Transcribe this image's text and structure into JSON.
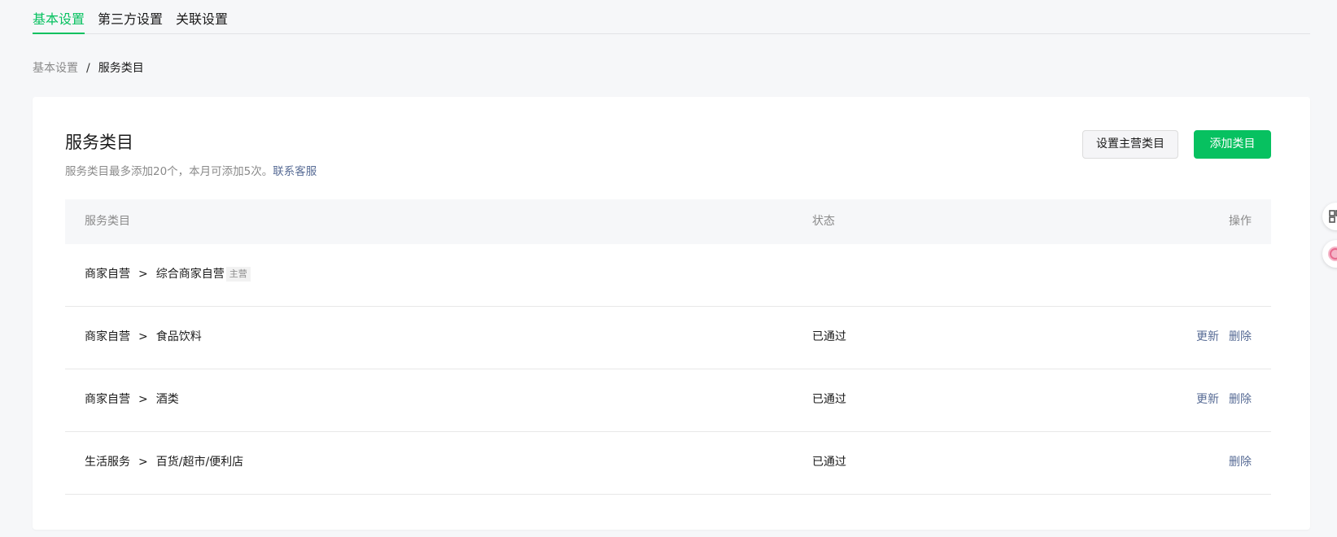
{
  "tabs": [
    {
      "label": "基本设置",
      "active": true
    },
    {
      "label": "第三方设置",
      "active": false
    },
    {
      "label": "关联设置",
      "active": false
    }
  ],
  "breadcrumb": {
    "root": "基本设置",
    "separator": "/",
    "current": "服务类目"
  },
  "card": {
    "title": "服务类目",
    "description": "服务类目最多添加20个，本月可添加5次。",
    "contact_link": "联系客服",
    "set_main_button": "设置主营类目",
    "add_button": "添加类目"
  },
  "table": {
    "headers": {
      "category": "服务类目",
      "status": "状态",
      "ops": "操作"
    },
    "rows": [
      {
        "primary": "商家自营",
        "arrow": ">",
        "secondary": "综合商家自营",
        "tag": "主营",
        "status": "",
        "update": "",
        "delete": ""
      },
      {
        "primary": "商家自营",
        "arrow": ">",
        "secondary": "食品饮料",
        "tag": "",
        "status": "已通过",
        "update": "更新",
        "delete": "删除"
      },
      {
        "primary": "商家自营",
        "arrow": ">",
        "secondary": "酒类",
        "tag": "",
        "status": "已通过",
        "update": "更新",
        "delete": "删除"
      },
      {
        "primary": "生活服务",
        "arrow": ">",
        "secondary": "百货/超市/便利店",
        "tag": "",
        "status": "已通过",
        "update": "",
        "delete": "删除"
      }
    ]
  },
  "widgets": [
    {
      "icon": "grid-icon",
      "color": "#555555"
    },
    {
      "icon": "coin-icon",
      "color": "#e86b8f"
    }
  ],
  "colors": {
    "accent": "#07c160",
    "link": "#576b95",
    "muted": "#8a8a8a"
  }
}
